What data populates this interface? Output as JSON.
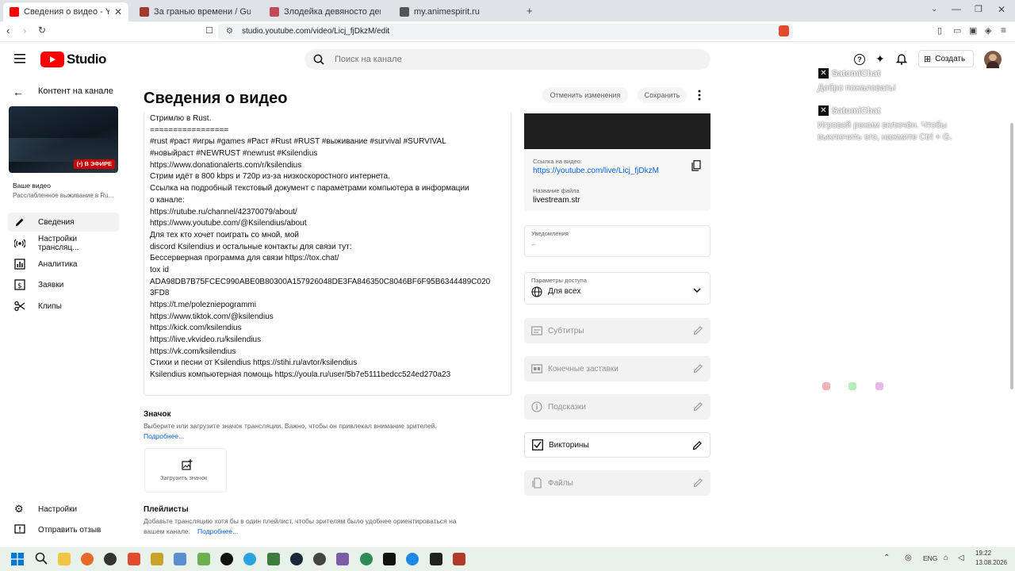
{
  "browser": {
    "tabs": [
      {
        "title": "Сведения о видео - YouTube St",
        "favicon_color": "#ff0000",
        "active": true
      },
      {
        "title": "За гранью времени / Guangyin Zhi",
        "favicon_color": "#9e3a2f",
        "active": false
      },
      {
        "title": "Злодейка девяносто девятого уров",
        "favicon_color": "#c04a5a",
        "active": false
      },
      {
        "title": "my.animespirit.ru",
        "favicon_color": "#555555",
        "active": false
      }
    ],
    "url": "studio.youtube.com/video/Licj_fjDkzM/edit"
  },
  "header": {
    "logo_text": "Studio",
    "search_placeholder": "Поиск на канале",
    "create_label": "Создать"
  },
  "sidebar": {
    "back_label": "Контент на канале",
    "live_badge": "В ЭФИРЕ",
    "your_video_label": "Ваше видео",
    "video_title": "Расслабленное выживание в Ru...",
    "items": [
      {
        "label": "Сведения",
        "icon": "pencil-icon",
        "active": true
      },
      {
        "label": "Настройки трансляц...",
        "icon": "broadcast-icon",
        "active": false
      },
      {
        "label": "Аналитика",
        "icon": "analytics-icon",
        "active": false
      },
      {
        "label": "Заявки",
        "icon": "claims-icon",
        "active": false
      },
      {
        "label": "Клипы",
        "icon": "scissors-icon",
        "active": false
      }
    ],
    "bottom_items": [
      {
        "label": "Настройки",
        "icon": "gear-icon"
      },
      {
        "label": "Отправить отзыв",
        "icon": "feedback-icon"
      }
    ]
  },
  "main": {
    "title": "Сведения о видео",
    "undo_label": "Отменить изменения",
    "save_label": "Сохранить",
    "description_lines": [
      "Стримлю в Rust.",
      "=================",
      "#rust #раст #игры #games #Раст #Rust #RUST #выживание #survival #SURVIVAL",
      "#новыйраст #NEWRUST #newrust #Ksilendius",
      "https://www.donationalerts.com/r/ksilendius",
      "Стрим идёт в 800 kbps и 720p из-за низкоскоростного интернета.",
      "Ссылка на подробный текстовый документ с параметрами компьютера в информации",
      "о канале:",
      "https://rutube.ru/channel/42370079/about/",
      "https://www.youtube.com/@Ksilendius/about",
      "Для тех кто хочет поиграть со мной, мой",
      "discord Ksilendius и остальные контакты для связи тут:",
      "Бессерверная программа для связи https://tox.chat/",
      "tox id",
      "ADA98DB7B75FCEC990ABE0B80300A157926048DE3FA846350C8046BF6F95B6344489C020",
      "3FD8",
      "https://t.me/polezniepogrammi",
      "https://www.tiktok.com/@ksilendius",
      "https://kick.com/ksilendius",
      "https://live.vkvideo.ru/ksilendius",
      "https://vk.com/ksilendius",
      "Стихи и песни от Ksilendius https://stihi.ru/avtor/ksilendius",
      "Ksilendius компьютерная помощь  https://youla.ru/user/5b7e5111bedcc524ed270a23"
    ],
    "thumbnail": {
      "title": "Значок",
      "text": "Выберите или загрузите значок трансляции. Важно, чтобы он привлекал внимание зрителей.",
      "more_link": "Подробнее...",
      "upload_label": "Загрузить значок"
    },
    "playlists": {
      "title": "Плейлисты",
      "text_line1": "Добавьте трансляцию хотя бы в один плейлист, чтобы зрителям было удобнее ориентироваться на",
      "text_line2": "вашем канале.",
      "more_link": "Подробнее..."
    }
  },
  "right_panel": {
    "video_link_label": "Ссылка на видео:",
    "video_link": "https://youtube.com/live/Licj_fjDkzM",
    "filename_label": "Название файла",
    "filename": "livestream.str",
    "notifications_label": "Уведомления",
    "notifications_value": "–",
    "access_label": "Параметры доступа",
    "access_value": "Для всех",
    "rows": [
      {
        "label": "Субтитры",
        "icon": "subtitles-icon",
        "enabled": false
      },
      {
        "label": "Конечные заставки",
        "icon": "endscreen-icon",
        "enabled": false
      },
      {
        "label": "Подсказки",
        "icon": "info-icon",
        "enabled": false
      },
      {
        "label": "Викторины",
        "icon": "checkbox-icon",
        "enabled": true
      },
      {
        "label": "Файлы",
        "icon": "files-icon",
        "enabled": false
      }
    ]
  },
  "chat_overlay": {
    "messages": [
      {
        "name": "SatomiChat",
        "text_lines": [
          "Добро пожаловать!"
        ]
      },
      {
        "name": "SatomiChat",
        "text_lines": [
          "Игровой режим включён. Чтобы",
          "выключить его, нажмите Ctrl + G."
        ]
      }
    ]
  },
  "taskbar": {
    "lang": "ENG",
    "time": "19:22",
    "date": "13.08.2026"
  }
}
